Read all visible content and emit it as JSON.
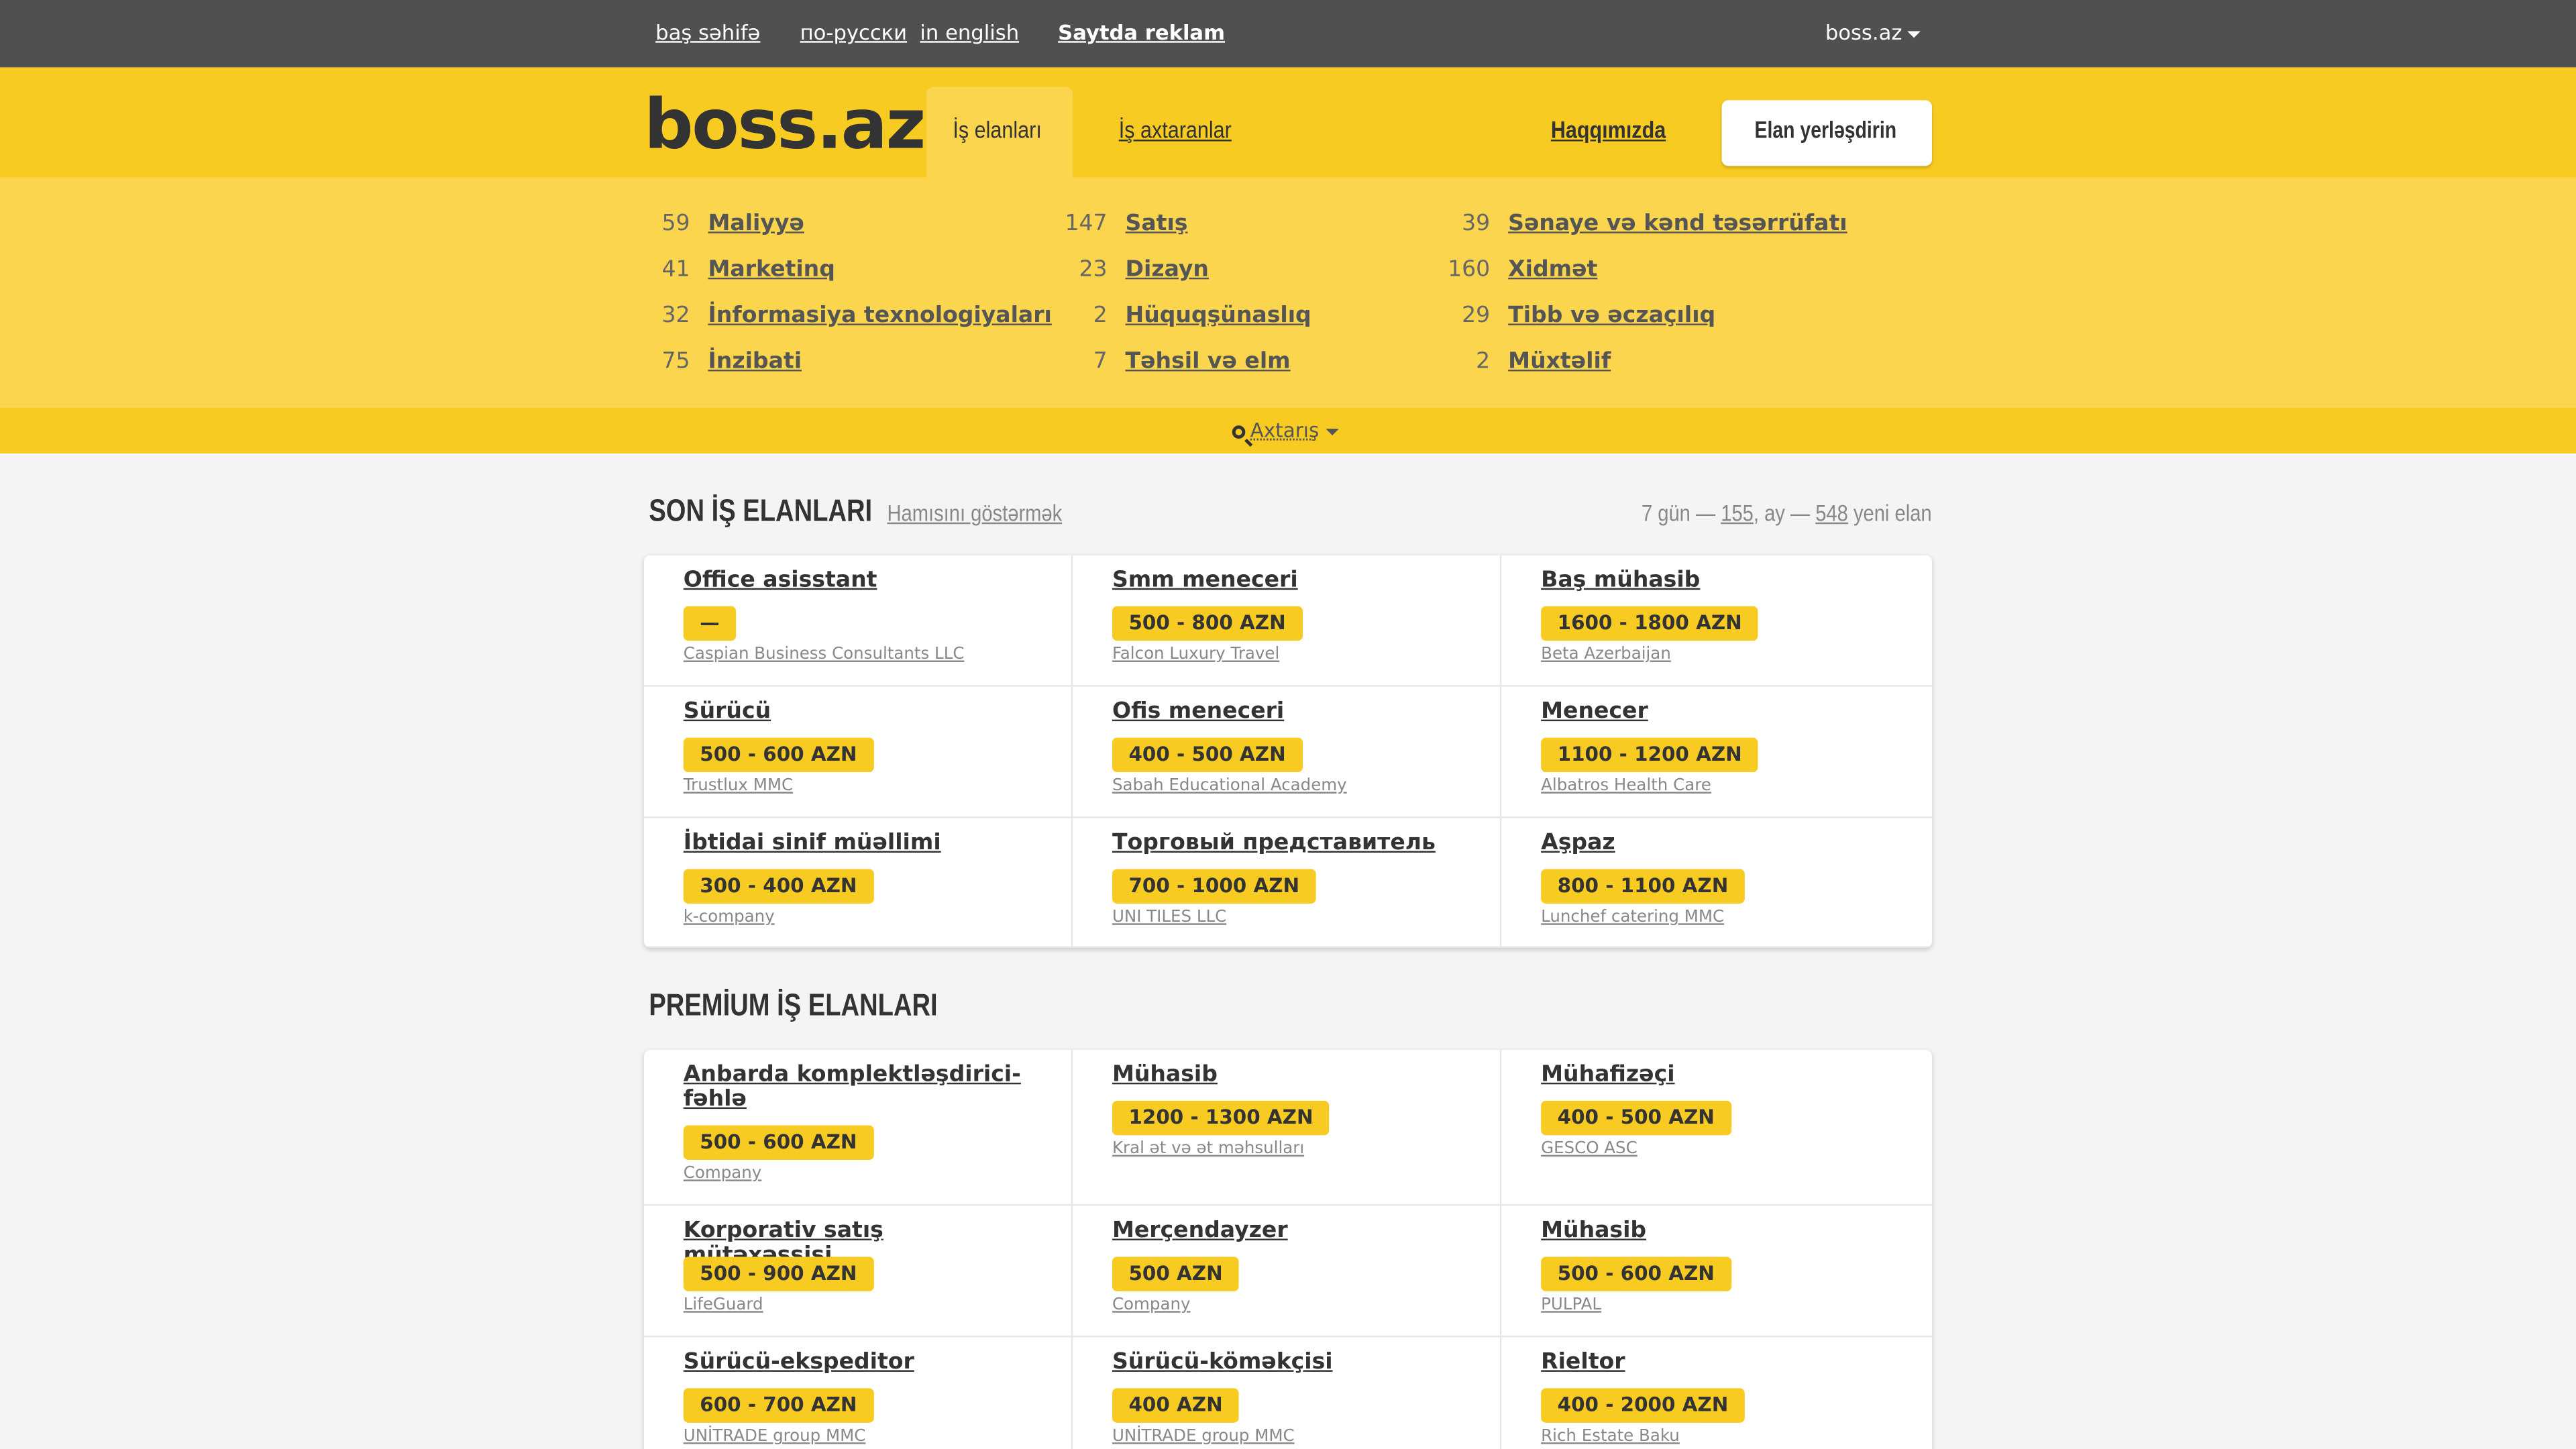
{
  "topbar": {
    "home": "baş səhifə",
    "russian": "по-русски",
    "english": "in english",
    "advertise": "Saytda reklam",
    "user": "boss.az"
  },
  "header": {
    "logo": "boss.az",
    "nav": [
      "İş elanları",
      "İş axtaranlar",
      "Haqqımızda"
    ],
    "cta": "Elan yerləşdirin"
  },
  "categories": [
    {
      "count": "59",
      "name": "Maliyyə"
    },
    {
      "count": "41",
      "name": "Marketinq"
    },
    {
      "count": "32",
      "name": "İnformasiya texnologiyaları"
    },
    {
      "count": "75",
      "name": "İnzibati"
    },
    {
      "count": "147",
      "name": "Satış"
    },
    {
      "count": "23",
      "name": "Dizayn"
    },
    {
      "count": "2",
      "name": "Hüquqşünaslıq"
    },
    {
      "count": "7",
      "name": "Təhsil və elm"
    },
    {
      "count": "39",
      "name": "Sənaye və kənd təsərrüfatı"
    },
    {
      "count": "160",
      "name": "Xidmət"
    },
    {
      "count": "29",
      "name": "Tibb və əczaçılıq"
    },
    {
      "count": "2",
      "name": "Müxtəlif"
    }
  ],
  "search": {
    "label": "Axtarış"
  },
  "latest": {
    "title": "SON İŞ ELANLARI",
    "show_all": "Hamısını göstərmək",
    "stats_prefix": "7 gün — ",
    "stats_week": "155",
    "stats_mid": ", ay — ",
    "stats_month": "548",
    "stats_suffix": " yeni elan",
    "jobs": [
      {
        "title": "Office asisstant",
        "salary": "—",
        "company": "Caspian Business Consultants LLC"
      },
      {
        "title": "Smm meneceri",
        "salary": "500 - 800 AZN",
        "company": "Falcon Luxury Travel"
      },
      {
        "title": "Baş mühasib",
        "salary": "1600 - 1800 AZN",
        "company": "Beta Azerbaijan"
      },
      {
        "title": "Sürücü",
        "salary": "500 - 600 AZN",
        "company": "Trustlux MMC"
      },
      {
        "title": "Ofis meneceri",
        "salary": "400 - 500 AZN",
        "company": "Sabah Educational Academy"
      },
      {
        "title": "Menecer",
        "salary": "1100 - 1200 AZN",
        "company": "Albatros Health Care"
      },
      {
        "title": "İbtidai sinif müəllimi",
        "salary": "300 - 400 AZN",
        "company": "k-company"
      },
      {
        "title": "Торговый представитель",
        "salary": "700 - 1000 AZN",
        "company": "UNI TILES LLC"
      },
      {
        "title": "Aşpaz",
        "salary": "800 - 1100 AZN",
        "company": "Lunchef catering MMC"
      }
    ]
  },
  "premium": {
    "title": "PREMİUM İŞ ELANLARI",
    "jobs": [
      {
        "title": "Anbarda komplektləşdirici-fəhlə",
        "salary": "500 - 600 AZN",
        "company": "Company"
      },
      {
        "title": "Mühasib",
        "salary": "1200 - 1300 AZN",
        "company": "Kral ət və ət məhsulları"
      },
      {
        "title": "Mühafizəçi",
        "salary": "400 - 500 AZN",
        "company": "GESCO ASC"
      },
      {
        "title": "Korporativ satış mütəxəssisi",
        "salary": "500 - 900 AZN",
        "company": "LifeGuard"
      },
      {
        "title": "Merçendayzer",
        "salary": "500 AZN",
        "company": "Company"
      },
      {
        "title": "Mühasib",
        "salary": "500 - 600 AZN",
        "company": "PULPAL"
      },
      {
        "title": "Sürücü-ekspeditor",
        "salary": "600 - 700 AZN",
        "company": "UNİTRADE group MMC"
      },
      {
        "title": "Sürücü-köməkçisi",
        "salary": "400 AZN",
        "company": "UNİTRADE group MMC"
      },
      {
        "title": "Rieltor",
        "salary": "400 - 2000 AZN",
        "company": "Rich Estate Baku"
      }
    ]
  }
}
